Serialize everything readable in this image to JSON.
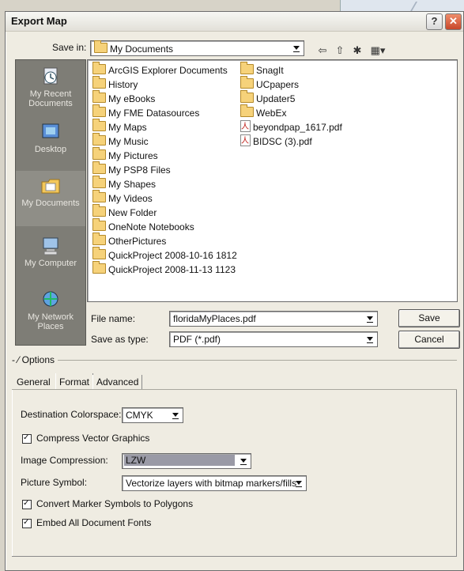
{
  "window": {
    "title": "Export Map"
  },
  "savein": {
    "label": "Save in:",
    "value": "My Documents"
  },
  "places": [
    {
      "label": "My Recent Documents"
    },
    {
      "label": "Desktop"
    },
    {
      "label": "My Documents"
    },
    {
      "label": "My Computer"
    },
    {
      "label": "My Network Places"
    }
  ],
  "files": {
    "col1": [
      "ArcGIS Explorer Documents",
      "History",
      "My eBooks",
      "My FME Datasources",
      "My Maps",
      "My Music",
      "My Pictures",
      "My PSP8 Files",
      "My Shapes",
      "My Videos",
      "New Folder",
      "OneNote Notebooks",
      "OtherPictures",
      "QuickProject 2008-10-16 1812",
      "QuickProject 2008-11-13 1123"
    ],
    "col2": [
      "SnagIt",
      "UCpapers",
      "Updater5",
      "WebEx",
      "beyondpap_1617.pdf",
      "BIDSC (3).pdf"
    ]
  },
  "filename": {
    "label": "File name:",
    "value": "floridaMyPlaces.pdf"
  },
  "saveastype": {
    "label": "Save as type:",
    "value": "PDF (*.pdf)"
  },
  "buttons": {
    "save": "Save",
    "cancel": "Cancel"
  },
  "options": {
    "label": "Options",
    "tabs": [
      "General",
      "Format",
      "Advanced"
    ],
    "active_tab": "Format",
    "destination_colorspace": {
      "label": "Destination Colorspace:",
      "value": "CMYK"
    },
    "compress_vector": {
      "label": "Compress Vector Graphics",
      "checked": true
    },
    "image_compression": {
      "label": "Image Compression:",
      "value": "LZW"
    },
    "picture_symbol": {
      "label": "Picture Symbol:",
      "value": "Vectorize layers with bitmap markers/fills"
    },
    "convert_marker": {
      "label": "Convert Marker Symbols to Polygons",
      "checked": true
    },
    "embed_fonts": {
      "label": "Embed All Document Fonts",
      "checked": true
    }
  }
}
